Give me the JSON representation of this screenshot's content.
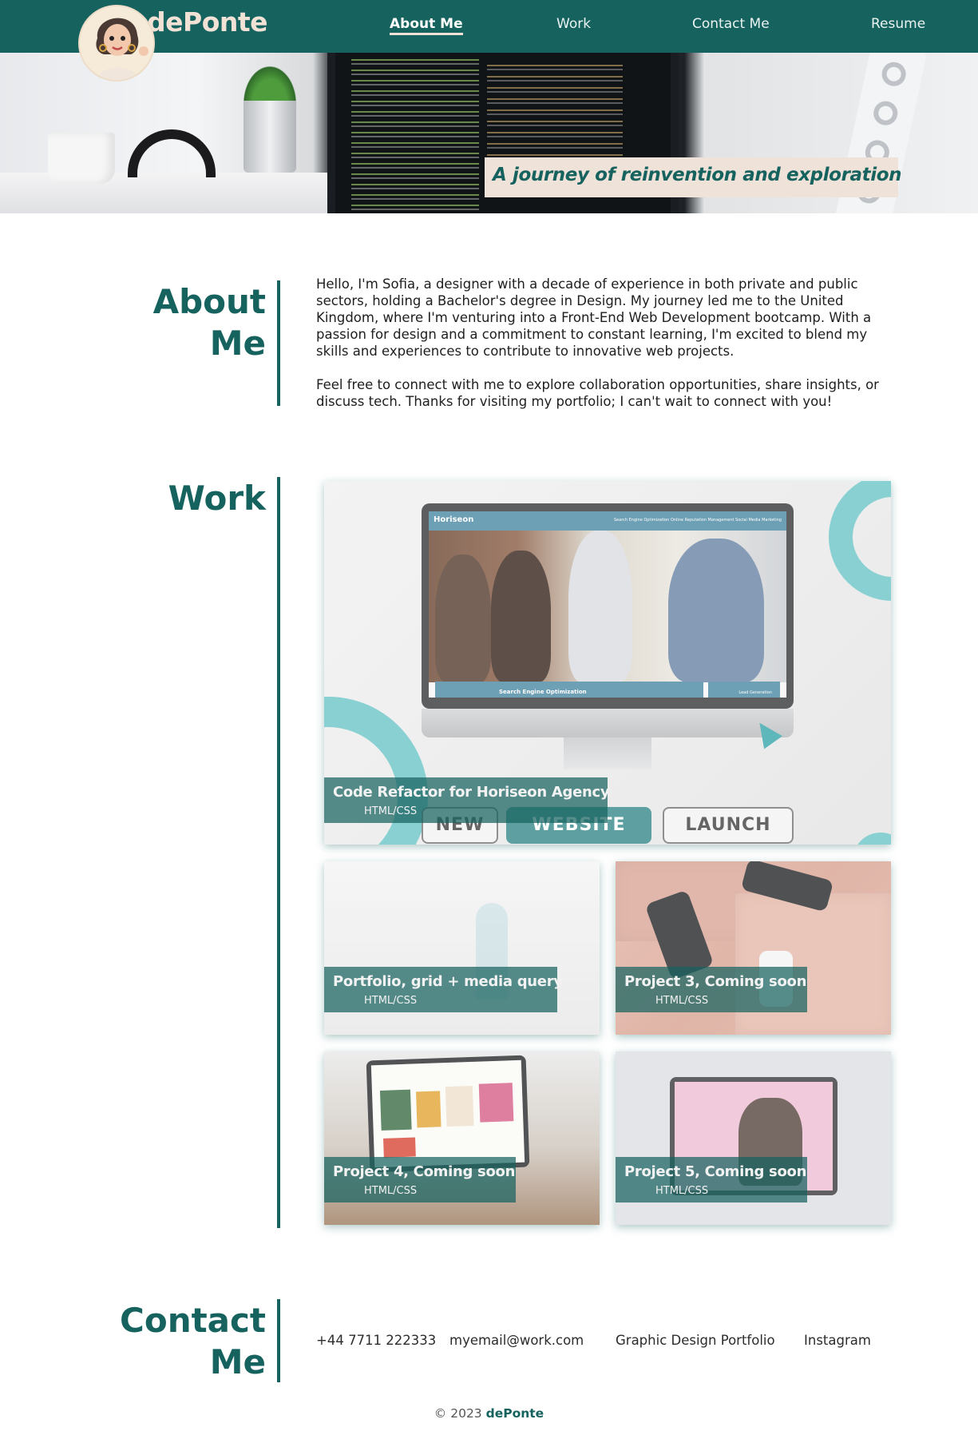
{
  "header": {
    "brand": "dePonte",
    "nav": [
      {
        "label": "About Me",
        "active": true
      },
      {
        "label": "Work"
      },
      {
        "label": "Contact Me"
      },
      {
        "label": "Resume"
      }
    ]
  },
  "hero": {
    "tagline": "A journey of reinvention and exploration"
  },
  "about": {
    "title_line1": "About",
    "title_line2": "Me",
    "paragraph1": "Hello, I'm Sofia, a designer with a decade of experience in both private and public sectors, holding a Bachelor's degree in Design. My journey led me to the United Kingdom, where I'm venturing into a Front-End Web Development bootcamp. With a passion for design and a commitment to constant learning, I'm excited to blend my skills and experiences to contribute to innovative web projects.",
    "paragraph2": "Feel free to connect with me to explore collaboration opportunities, share insights, or discuss tech. Thanks for visiting my portfolio; I can't wait to connect with you!"
  },
  "work": {
    "title": "Work",
    "featured": {
      "title": "Code Refactor for Horiseon Agency",
      "tag": "HTML/CSS",
      "screen_brand": "Horiseon",
      "screen_nav": "Search Engine Optimization   Online Reputation Management   Social Media Marketing",
      "screen_banner": "Search Engine Optimization",
      "screen_side": "Lead Generation",
      "buttons": [
        "NEW",
        "WEBSITE",
        "LAUNCH"
      ]
    },
    "projects": [
      {
        "title": "Portfolio, grid + media query",
        "tag": "HTML/CSS"
      },
      {
        "title": "Project 3, Coming soon",
        "tag": "HTML/CSS"
      },
      {
        "title": "Project 4, Coming soon",
        "tag": "HTML/CSS"
      },
      {
        "title": "Project 5, Coming soon",
        "tag": "HTML/CSS"
      }
    ]
  },
  "contact": {
    "title_line1": "Contact",
    "title_line2": "Me",
    "links": [
      "+44 7711 222333",
      "myemail@work.com",
      "Graphic Design Portfolio",
      "Instagram"
    ]
  },
  "footer": {
    "prefix": "© 2023",
    "brand": "dePonte"
  },
  "colors": {
    "primary": "#16625f",
    "accent": "#efe2d8",
    "teal_light": "#6fc6c8"
  }
}
